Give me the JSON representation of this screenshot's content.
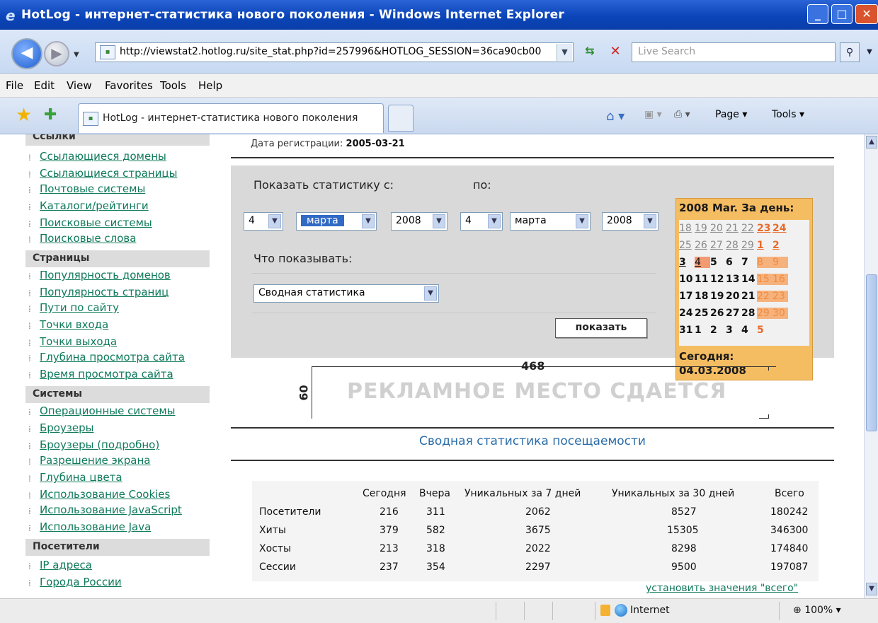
{
  "window": {
    "title": "HotLog - интернет-статистика нового поколения - Windows Internet Explorer",
    "buttons": {
      "min": "_",
      "max": "□",
      "close": "✕"
    }
  },
  "address": {
    "url": "http://viewstat2.hotlog.ru/site_stat.php?id=257996&HOTLOG_SESSION=36ca90cb00",
    "search_placeholder": "Live Search"
  },
  "menu": [
    "File",
    "Edit",
    "View",
    "Favorites",
    "Tools",
    "Help"
  ],
  "tabs": {
    "active": "HotLog - интернет-статистика нового поколения",
    "commands": {
      "page": "Page ▾",
      "tools": "Tools ▾"
    }
  },
  "sidebar": {
    "top_partial": "Ссылки",
    "links_group": [
      "Ссылающиеся домены",
      "Ссылающиеся страницы",
      "Почтовые системы",
      "Каталоги/рейтинги",
      "Поисковые системы",
      "Поисковые слова"
    ],
    "pages_head": "Страницы",
    "pages_group": [
      "Популярность доменов",
      "Популярность страниц",
      "Пути по сайту",
      "Точки входа",
      "Точки выхода",
      "Глубина просмотра сайта",
      "Время просмотра сайта"
    ],
    "systems_head": "Системы",
    "systems_group": [
      "Операционные системы",
      "Броузеры",
      "Броузеры (подробно)",
      "Разрешение экрана",
      "Глубина цвета",
      "Использование Cookies",
      "Использование JavaScript",
      "Использование Java"
    ],
    "visitors_head": "Посетители",
    "visitors_group": [
      "IP адреса",
      "Города России"
    ]
  },
  "main": {
    "reg_label": "Дата регистрации:",
    "reg_date": "2005-03-21",
    "show_from": "Показать статистику с:",
    "show_to": "по:",
    "from": {
      "day": "4",
      "month": "марта",
      "year": "2008"
    },
    "to": {
      "day": "4",
      "month": "марта",
      "year": "2008"
    },
    "what_label": "Что показывать:",
    "what_value": "Сводная статистика",
    "show_button": "показать"
  },
  "calendar": {
    "title": "2008 Mar. За день:",
    "today_label": "Сегодня:",
    "today_value": "04.03.2008",
    "rows": [
      [
        "18",
        "19",
        "20",
        "21",
        "22",
        "23",
        "24"
      ],
      [
        "25",
        "26",
        "27",
        "28",
        "29",
        "1",
        "2"
      ],
      [
        "3",
        "4",
        "5",
        "6",
        "7",
        "8",
        "9"
      ],
      [
        "10",
        "11",
        "12",
        "13",
        "14",
        "15",
        "16"
      ],
      [
        "17",
        "18",
        "19",
        "20",
        "21",
        "22",
        "23"
      ],
      [
        "24",
        "25",
        "26",
        "27",
        "28",
        "29",
        "30"
      ],
      [
        "31",
        "1",
        "2",
        "3",
        "4",
        "5",
        ""
      ]
    ]
  },
  "banner": {
    "width": "468",
    "height": "60",
    "text": "РЕКЛАМНОЕ МЕСТО СДАЕТСЯ"
  },
  "summary": {
    "title": "Сводная статистика посещаемости",
    "headers": [
      "Сегодня",
      "Вчера",
      "Уникальных за 7 дней",
      "Уникальных за 30 дней",
      "Всего"
    ],
    "rows": [
      {
        "label": "Посетители",
        "values": [
          "216",
          "311",
          "2062",
          "8527",
          "180242"
        ]
      },
      {
        "label": "Хиты",
        "values": [
          "379",
          "582",
          "3675",
          "15305",
          "346300"
        ]
      },
      {
        "label": "Хосты",
        "values": [
          "213",
          "318",
          "2022",
          "8298",
          "174840"
        ]
      },
      {
        "label": "Сессии",
        "values": [
          "237",
          "354",
          "2297",
          "9500",
          "197087"
        ]
      }
    ],
    "set_total": "установить значения \"всего\""
  },
  "status": {
    "zone": "Internet",
    "zoom": "100%"
  }
}
